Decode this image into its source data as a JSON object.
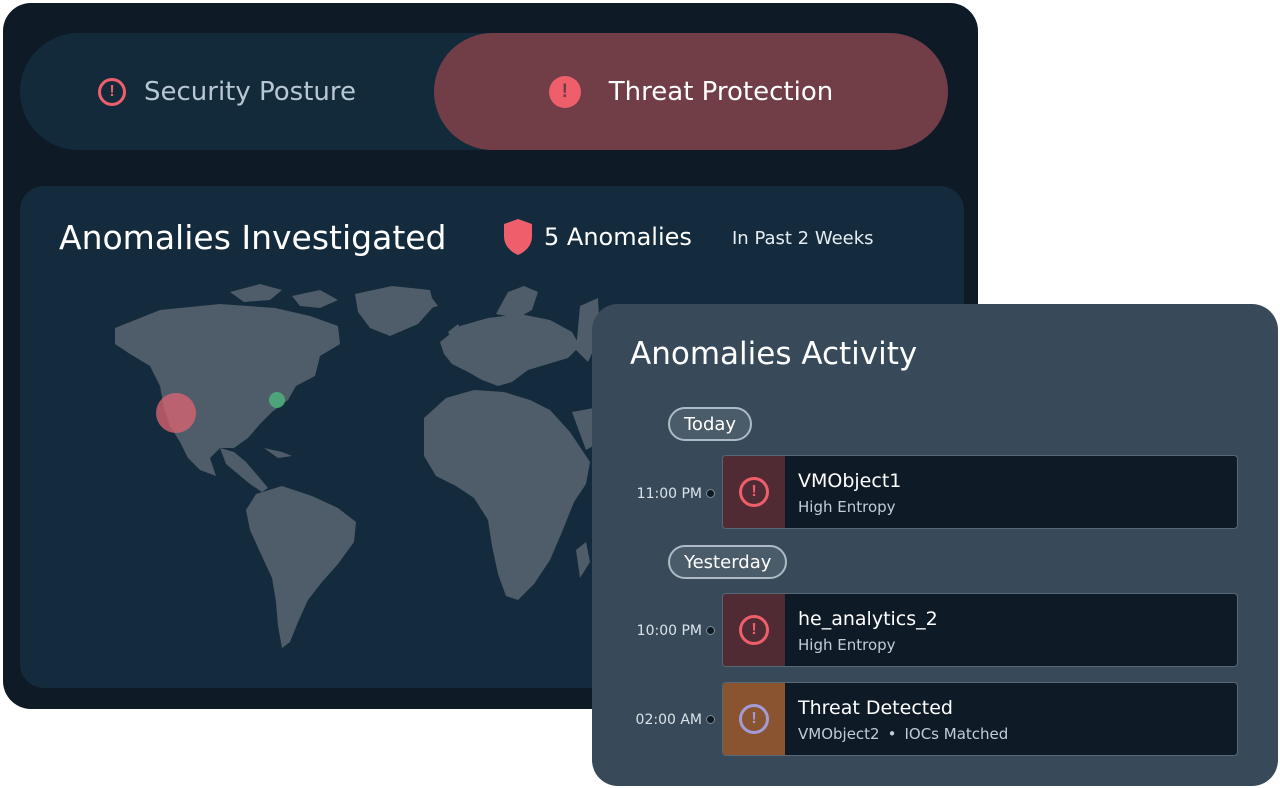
{
  "tabs": [
    {
      "label": "Security Posture",
      "active": false,
      "icon": "alert-circle-outline-icon"
    },
    {
      "label": "Threat Protection",
      "active": true,
      "icon": "alert-circle-filled-icon"
    }
  ],
  "map": {
    "title": "Anomalies Investigated",
    "count_label": "5 Anomalies",
    "period": "In Past 2 Weeks",
    "icon": "shield-icon"
  },
  "activity": {
    "title": "Anomalies Activity",
    "groups": [
      {
        "label": "Today",
        "events": [
          {
            "time": "11:00 PM",
            "name": "VMObject1",
            "desc": "High Entropy",
            "severity": "critical"
          }
        ]
      },
      {
        "label": "Yesterday",
        "events": [
          {
            "time": "10:00 PM",
            "name": "he_analytics_2",
            "desc": "High Entropy",
            "severity": "critical"
          },
          {
            "time": "02:00 AM",
            "name": "Threat Detected",
            "desc_object": "VMObject2",
            "desc_sep": "•",
            "desc_detail": "IOCs Matched",
            "severity": "warning"
          }
        ]
      }
    ]
  },
  "colors": {
    "accent_red": "#ef5f6b",
    "active_tab": "#713d47",
    "warning": "#8a5430",
    "map_land": "#4e5d69"
  }
}
